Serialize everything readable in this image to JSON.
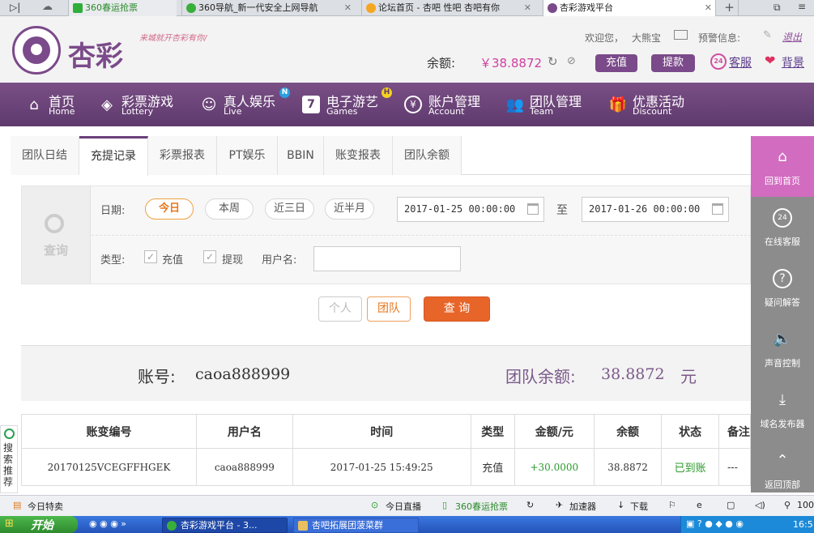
{
  "browser": {
    "tabs": [
      {
        "title": "360春运抢票",
        "color": "#2fae3a",
        "active": false
      },
      {
        "title": "360导航_新一代安全上网导航",
        "color": "#3aae3a",
        "active": false
      },
      {
        "title": "论坛首页 - 杏吧  性吧  杏吧有你",
        "color": "#f5a623",
        "active": false
      },
      {
        "title": "杏彩游戏平台",
        "color": "#7b4a8a",
        "active": true
      }
    ]
  },
  "header": {
    "logo_text": "杏彩",
    "slogan": "来城就开杏彩有你/",
    "welcome": "欢迎您，",
    "username": "大熊宝",
    "warn_label": "预警信息:",
    "logout": "退出",
    "balance_label": "余额:",
    "balance_value": "￥38.8872",
    "deposit": "充值",
    "withdraw": "提款",
    "service": "客服",
    "background": "背景"
  },
  "nav": [
    {
      "title": "首页",
      "sub": "Home",
      "icon": "home-icon",
      "badge": ""
    },
    {
      "title": "彩票游戏",
      "sub": "Lottery",
      "icon": "lottery-icon",
      "badge": ""
    },
    {
      "title": "真人娱乐",
      "sub": "Live",
      "icon": "live-dealer-icon",
      "badge": "N"
    },
    {
      "title": "电子游艺",
      "sub": "Games",
      "icon": "games-icon",
      "badge": "H"
    },
    {
      "title": "账户管理",
      "sub": "Account",
      "icon": "account-icon",
      "badge": ""
    },
    {
      "title": "团队管理",
      "sub": "Team",
      "icon": "team-icon",
      "badge": ""
    },
    {
      "title": "优惠活动",
      "sub": "Discount",
      "icon": "gift-icon",
      "badge": ""
    }
  ],
  "subtabs": [
    "团队日结",
    "充提记录",
    "彩票报表",
    "PT娱乐",
    "BBIN",
    "账变报表",
    "团队余额"
  ],
  "active_subtab": "充提记录",
  "search": {
    "query_label": "查询",
    "date_label": "日期:",
    "ranges": [
      "今日",
      "本周",
      "近三日",
      "近半月"
    ],
    "active_range": "今日",
    "date_from": "2017-01-25 00:00:00",
    "to_label": "至",
    "date_to": "2017-01-26 00:00:00",
    "type_label": "类型:",
    "type_deposit": "充值",
    "type_withdraw": "提现",
    "username_label": "用户名:",
    "username_value": "",
    "btn_personal": "个人",
    "btn_team": "团队",
    "btn_query": "查 询"
  },
  "account": {
    "account_label": "账号:",
    "account_value": "caoa888999",
    "team_balance_label": "团队余额:",
    "team_balance_value": "38.8872",
    "unit": "元"
  },
  "table": {
    "headers": [
      "账变编号",
      "用户名",
      "时间",
      "类型",
      "金额/元",
      "余额",
      "状态",
      "备注"
    ],
    "rows": [
      [
        "20170125VCEGFFHGEK",
        "caoa888999",
        "2017-01-25 15:49:25",
        "充值",
        "+30.0000",
        "38.8872",
        "已到账",
        "---"
      ]
    ]
  },
  "sidebar": [
    {
      "label": "回到首页",
      "icon": "home-icon"
    },
    {
      "label": "在线客服",
      "icon": "headset-icon"
    },
    {
      "label": "疑问解答",
      "icon": "question-icon"
    },
    {
      "label": "声音控制",
      "icon": "speaker-icon"
    },
    {
      "label": "域名发布器",
      "icon": "download-icon"
    },
    {
      "label": "返回顶部",
      "icon": "arrow-up-icon"
    }
  ],
  "left_float": "搜索推荐",
  "statusbar": {
    "left": "今日特卖",
    "live": "今日直播",
    "ticket": "360春运抢票",
    "accelerator": "加速器",
    "download": "下载",
    "zoom": "100"
  },
  "taskbar": {
    "start": "开始",
    "items": [
      "杏彩游戏平台 - 3...",
      "杏吧拓展团菠菜群"
    ],
    "clock": "16:5"
  },
  "colors": {
    "brand": "#6b3f7a",
    "accent_orange": "#e8652a",
    "money_pink": "#d040a0",
    "success_green": "#2a9a2a"
  }
}
